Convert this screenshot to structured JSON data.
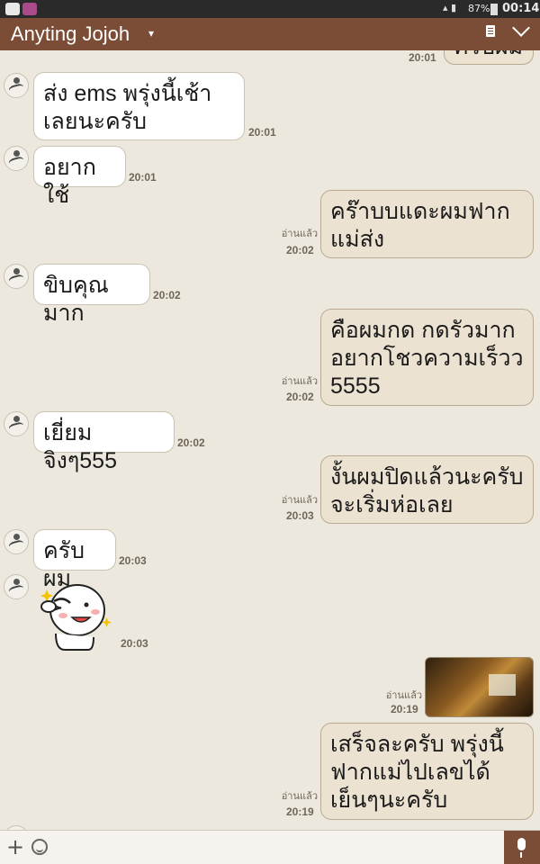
{
  "status_bar": {
    "battery": "87%",
    "time": "00:14"
  },
  "header": {
    "title": "Anyting Jojoh",
    "caret": "▾"
  },
  "messages": [
    {
      "dir": "out",
      "text": "ครับผม",
      "time": "20:01"
    },
    {
      "dir": "in",
      "text": "ส่ง ems พรุ่งนี้เช้า\nเลยนะครับ",
      "time": "20:01"
    },
    {
      "dir": "in",
      "text": "อยากใช้",
      "time": "20:01"
    },
    {
      "dir": "out",
      "text": "คร๊าบบแดะผมฟาก\nแม่ส่ง",
      "read": "อ่านแล้ว",
      "time": "20:02"
    },
    {
      "dir": "in",
      "text": "ขิบคุณมาก",
      "time": "20:02"
    },
    {
      "dir": "out",
      "text": " คือผมกด กดรัวมาก\nอยากโชวความเร็วว\n5555",
      "read": "อ่านแล้ว",
      "time": "20:02"
    },
    {
      "dir": "in",
      "text": "เยี่ยมจิงๆ555",
      "time": "20:02"
    },
    {
      "dir": "out",
      "text": "งั้นผมปิดแล้วนะครับ\nจะเริ่มห่อเลย",
      "read": "อ่านแล้ว",
      "time": "20:03"
    },
    {
      "dir": "in",
      "text": "ครับผม",
      "time": "20:03"
    },
    {
      "dir": "in",
      "type": "sticker",
      "time": "20:03"
    },
    {
      "dir": "out",
      "type": "photo",
      "read": "อ่านแล้ว",
      "time": "20:19"
    },
    {
      "dir": "out",
      "text": "เสร็จละครับ พรุ่งนี้\nฟากแม่ไปเลขได้\nเย็นๆนะครับ",
      "read": "อ่านแล้ว",
      "time": "20:19"
    }
  ],
  "icons": {
    "status_app": "line-app-icon",
    "header_menu": "notes-icon",
    "header_collapse": "chevron-down-icon",
    "input_add": "plus-icon",
    "input_emoji": "emoji-icon",
    "input_voice": "microphone-icon"
  },
  "colors": {
    "header": "#7b4d36",
    "background": "#ede8dd",
    "outgoing_bubble": "#ece2d2",
    "incoming_bubble": "#ffffff"
  }
}
